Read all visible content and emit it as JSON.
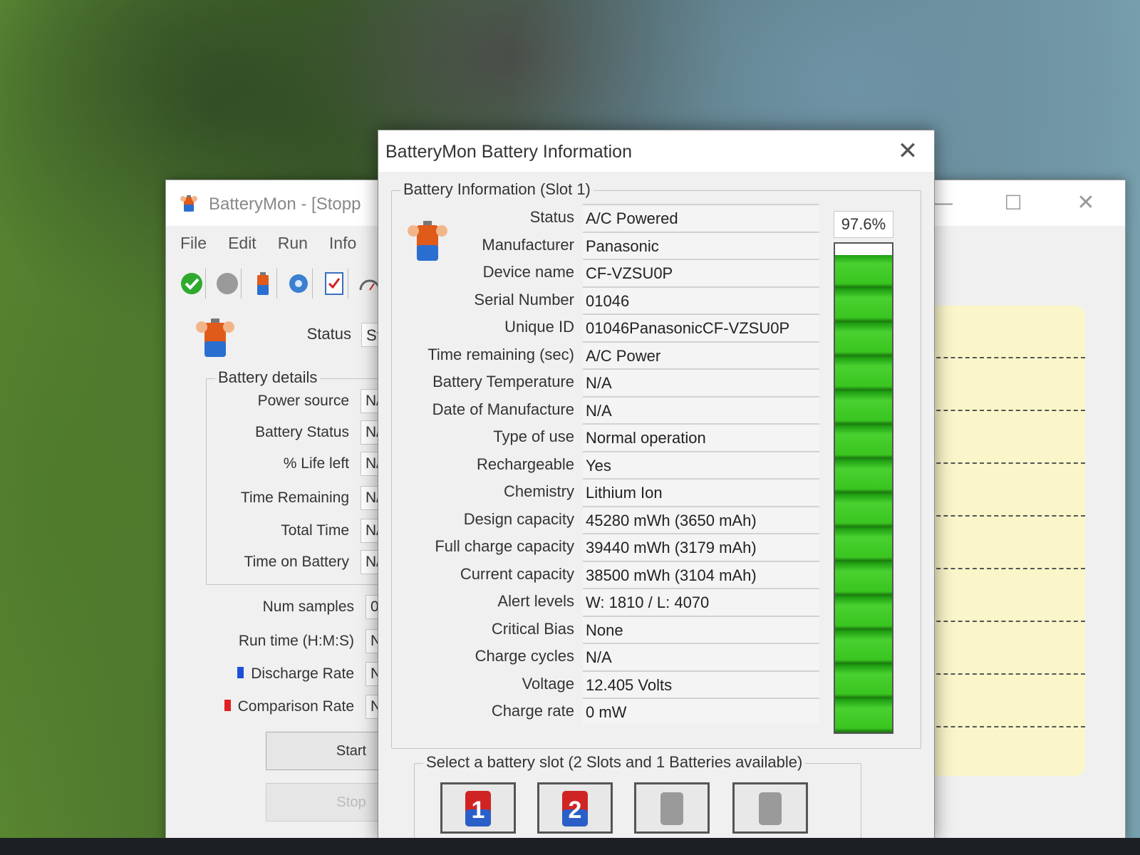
{
  "main_window": {
    "title": "BatteryMon - [Stopp",
    "controls": {
      "minimize": "—",
      "maximize": "☐",
      "close": "✕"
    },
    "menu": [
      "File",
      "Edit",
      "Run",
      "Info"
    ],
    "toolbar_icons": [
      "check-icon",
      "stop-circle-icon",
      "battery-icon",
      "gear-icon",
      "checklist-icon",
      "gauge-icon"
    ],
    "status_label": "Status",
    "status_value": "Sto",
    "details": {
      "title": "Battery details",
      "rows": [
        {
          "label": "Power source",
          "value": "N/"
        },
        {
          "label": "Battery Status",
          "value": "N/"
        },
        {
          "label": "% Life left",
          "value": "N/"
        },
        {
          "label": "Time Remaining",
          "value": "N/"
        },
        {
          "label": "Total Time",
          "value": "N/"
        },
        {
          "label": "Time on Battery",
          "value": "N/"
        }
      ]
    },
    "extra_rows": [
      {
        "label": "Num samples",
        "value": "0"
      },
      {
        "label": "Run time (H:M:S)",
        "value": "N/"
      },
      {
        "label": "Discharge Rate",
        "value": "N/"
      },
      {
        "label": "Comparison Rate",
        "value": "No"
      }
    ],
    "start_label": "Start",
    "stop_label": "Stop",
    "colors": {
      "discharge": "#1e4fd8",
      "comparison": "#e02020"
    }
  },
  "dialog": {
    "title": "BatteryMon Battery Information",
    "close": "✕",
    "info_title": "Battery Information (Slot 1)",
    "charge_percent": "97.6%",
    "charge_fraction": 0.976,
    "rows": [
      {
        "label": "Status",
        "value": "A/C Powered"
      },
      {
        "label": "Manufacturer",
        "value": "Panasonic"
      },
      {
        "label": "Device name",
        "value": "CF-VZSU0P"
      },
      {
        "label": "Serial Number",
        "value": "01046"
      },
      {
        "label": "Unique ID",
        "value": "01046PanasonicCF-VZSU0P"
      },
      {
        "label": "Time remaining (sec)",
        "value": "A/C Power"
      },
      {
        "label": "Battery Temperature",
        "value": "N/A"
      },
      {
        "label": "Date of Manufacture",
        "value": "N/A"
      },
      {
        "label": "Type of use",
        "value": "Normal operation"
      },
      {
        "label": "Rechargeable",
        "value": "Yes"
      },
      {
        "label": "Chemistry",
        "value": "Lithium Ion"
      },
      {
        "label": "Design capacity",
        "value": "45280 mWh (3650 mAh)"
      },
      {
        "label": "Full charge capacity",
        "value": "39440 mWh (3179 mAh)"
      },
      {
        "label": "Current capacity",
        "value": "38500 mWh (3104 mAh)"
      },
      {
        "label": "Alert levels",
        "value": "W: 1810 / L: 4070"
      },
      {
        "label": "Critical Bias",
        "value": "None"
      },
      {
        "label": "Charge cycles",
        "value": "N/A"
      },
      {
        "label": "Voltage",
        "value": "12.405 Volts"
      },
      {
        "label": "Charge rate",
        "value": "0 mW"
      }
    ],
    "slot_group_title": "Select a battery slot (2 Slots and 1 Batteries available)",
    "slots": [
      {
        "number": "1",
        "available": true
      },
      {
        "number": "2",
        "available": true
      },
      {
        "number": "",
        "available": false
      },
      {
        "number": "",
        "available": false
      }
    ]
  }
}
